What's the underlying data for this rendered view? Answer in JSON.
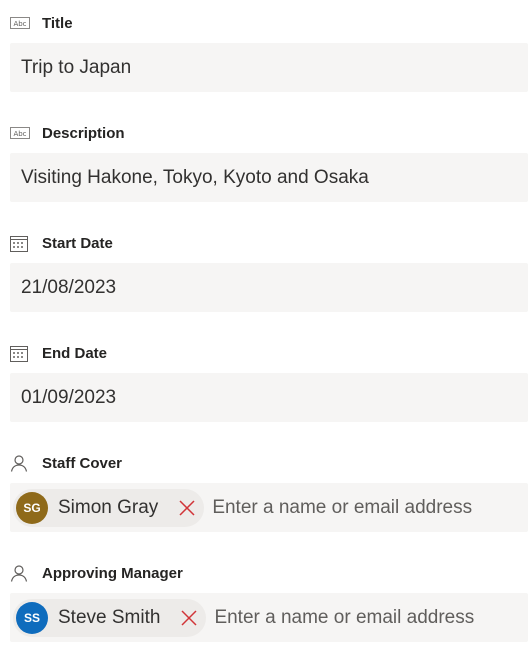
{
  "fields": {
    "title": {
      "label": "Title",
      "value": "Trip to Japan",
      "icon": "text-field-icon"
    },
    "description": {
      "label": "Description",
      "value": "Visiting Hakone, Tokyo, Kyoto and Osaka",
      "icon": "text-field-icon"
    },
    "start_date": {
      "label": "Start Date",
      "value": "21/08/2023",
      "icon": "calendar-icon"
    },
    "end_date": {
      "label": "End Date",
      "value": "01/09/2023",
      "icon": "calendar-icon"
    },
    "staff_cover": {
      "label": "Staff Cover",
      "icon": "person-icon",
      "person": {
        "initials": "SG",
        "name": "Simon Gray",
        "avatar_color": "#8f6a1a"
      },
      "placeholder": "Enter a name or email address"
    },
    "approving_manager": {
      "label": "Approving Manager",
      "icon": "person-icon",
      "person": {
        "initials": "SS",
        "name": "Steve Smith",
        "avatar_color": "#0f6cbd"
      },
      "placeholder": "Enter a name or email address"
    }
  },
  "colors": {
    "field_bg": "#f6f5f4",
    "pill_bg": "#edebe9",
    "remove_x": "#d13438",
    "label_text": "#252423"
  }
}
